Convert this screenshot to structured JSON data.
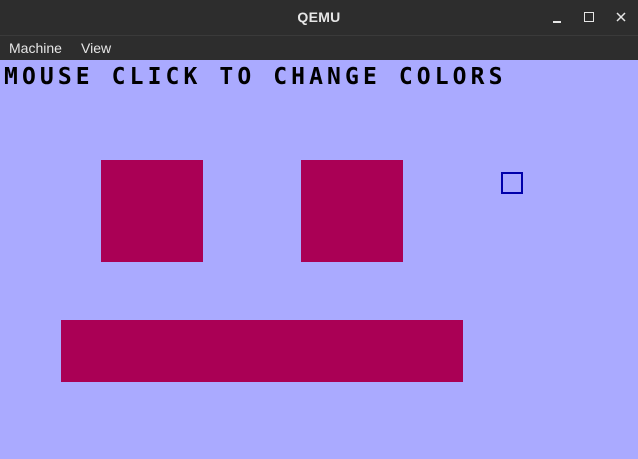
{
  "window": {
    "title": "QEMU",
    "controls": {
      "minimize_icon": "minimize-icon",
      "maximize_icon": "maximize-icon",
      "close_icon": "close-icon"
    }
  },
  "menubar": {
    "items": [
      {
        "label": "Machine"
      },
      {
        "label": "View"
      }
    ]
  },
  "screen": {
    "heading": "MOUSE CLICK TO CHANGE COLORS",
    "colors": {
      "background": "#aaaaff",
      "shapes": "#aa0055",
      "cursor": "#0000aa",
      "text": "#000000"
    }
  }
}
